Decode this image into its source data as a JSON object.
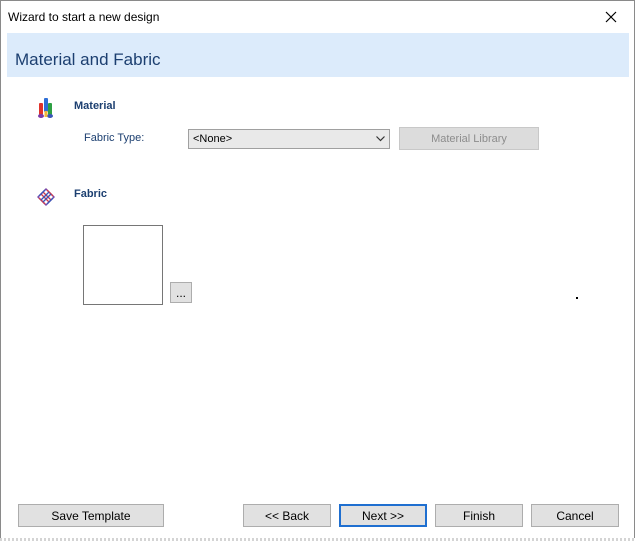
{
  "window": {
    "title": "Wizard to start a new design"
  },
  "header": {
    "title": "Material and Fabric"
  },
  "material": {
    "section_label": "Material",
    "fabric_type_label": "Fabric Type:",
    "fabric_type_value": "<None>",
    "library_button": "Material Library"
  },
  "fabric": {
    "section_label": "Fabric",
    "browse_button": "..."
  },
  "footer": {
    "save_template": "Save Template",
    "back": "<< Back",
    "next": "Next >>",
    "finish": "Finish",
    "cancel": "Cancel"
  },
  "icons": {
    "close": "close-icon",
    "material": "material-spools-icon",
    "fabric": "fabric-weave-icon",
    "dropdown": "chevron-down-icon"
  },
  "colors": {
    "header_band": "#dcebfb",
    "header_text": "#1c3f70",
    "default_button_border": "#1f6fd0"
  }
}
